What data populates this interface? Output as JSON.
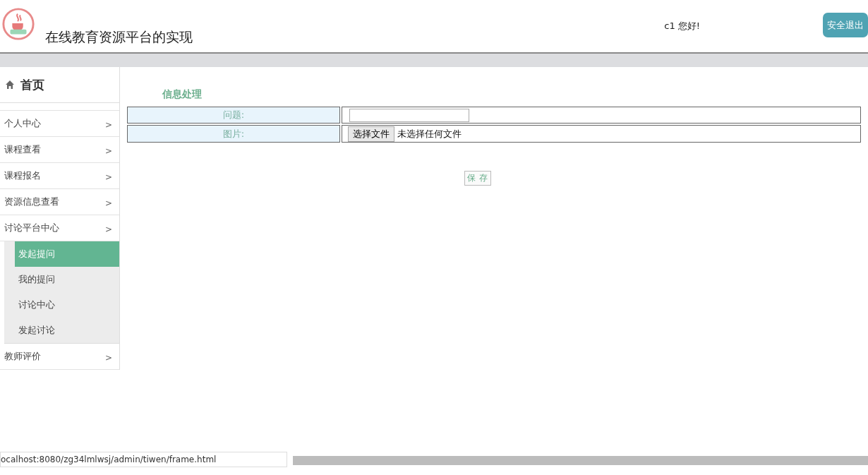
{
  "header": {
    "title": "在线教育资源平台的实现",
    "greeting": "c1 您好!",
    "logout": "安全退出"
  },
  "sidebar": {
    "home": "首页",
    "items": [
      {
        "label": "个人中心",
        "arrow": ">"
      },
      {
        "label": "课程查看",
        "arrow": ">"
      },
      {
        "label": "课程报名",
        "arrow": ">"
      },
      {
        "label": "资源信息查看",
        "arrow": ">"
      },
      {
        "label": "讨论平台中心",
        "arrow": ">",
        "children": [
          {
            "label": "发起提问",
            "selected": true
          },
          {
            "label": "我的提问",
            "selected": false
          },
          {
            "label": "讨论中心",
            "selected": false
          },
          {
            "label": "发起讨论",
            "selected": false
          }
        ]
      },
      {
        "label": "教师评价",
        "arrow": ">"
      }
    ]
  },
  "form": {
    "title": "信息处理",
    "rows": [
      {
        "kind": "text",
        "label": "问题:"
      },
      {
        "kind": "file",
        "label": "图片:",
        "button": "选择文件",
        "status": "未选择任何文件"
      }
    ],
    "save": "保 存"
  },
  "status_url": "ocalhost:8080/zg34lmlwsj/admin/tiwen/frame.html"
}
